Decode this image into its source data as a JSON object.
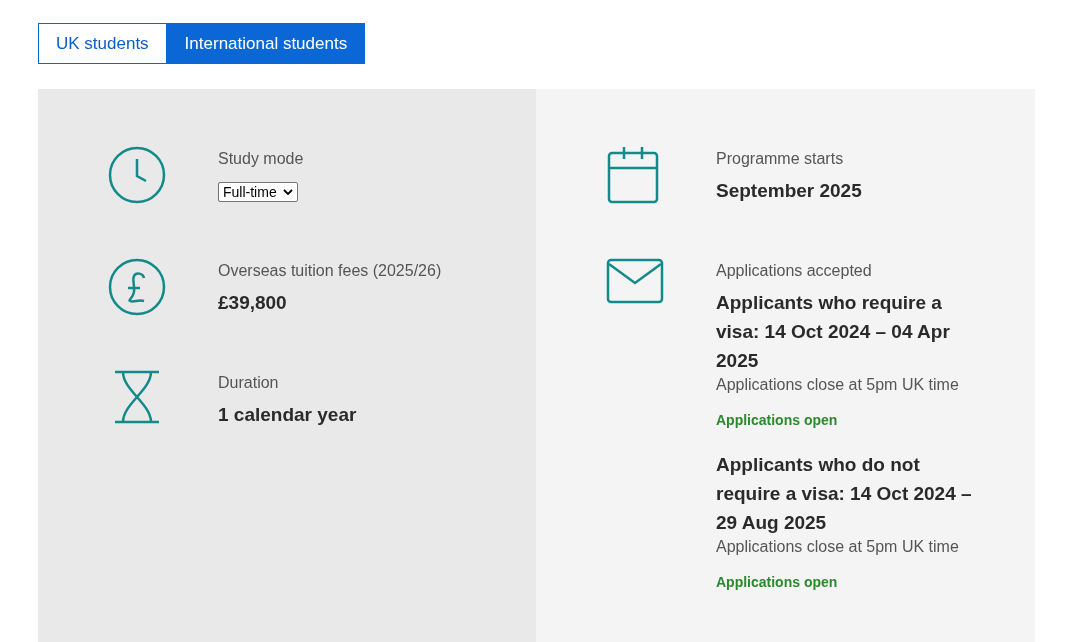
{
  "tabs": [
    {
      "label": "UK students",
      "selected": false
    },
    {
      "label": "International students",
      "selected": true
    }
  ],
  "columns": [
    {
      "items": [
        {
          "kind": "clock",
          "label": "Study mode",
          "select": {
            "value": "Full-time"
          }
        },
        {
          "kind": "pound",
          "label": "Overseas tuition fees (2025/26)",
          "value": "£39,800"
        },
        {
          "kind": "hourglass",
          "label": "Duration",
          "value": "1 calendar year"
        }
      ]
    },
    {
      "items": [
        {
          "kind": "calendar",
          "label": "Programme starts",
          "value": "September 2025"
        },
        {
          "kind": "envelope",
          "label": "Applications accepted",
          "groups": [
            {
              "value": "Applicants who require a visa: 14 Oct 2024 – 04 Apr 2025",
              "note": "Applications close at 5pm UK time",
              "status": "Applications open"
            },
            {
              "value": "Applicants who do not require a visa: 14 Oct 2024 – 29 Aug 2025",
              "note": "Applications close at 5pm UK time",
              "status": "Applications open"
            }
          ]
        }
      ]
    }
  ]
}
